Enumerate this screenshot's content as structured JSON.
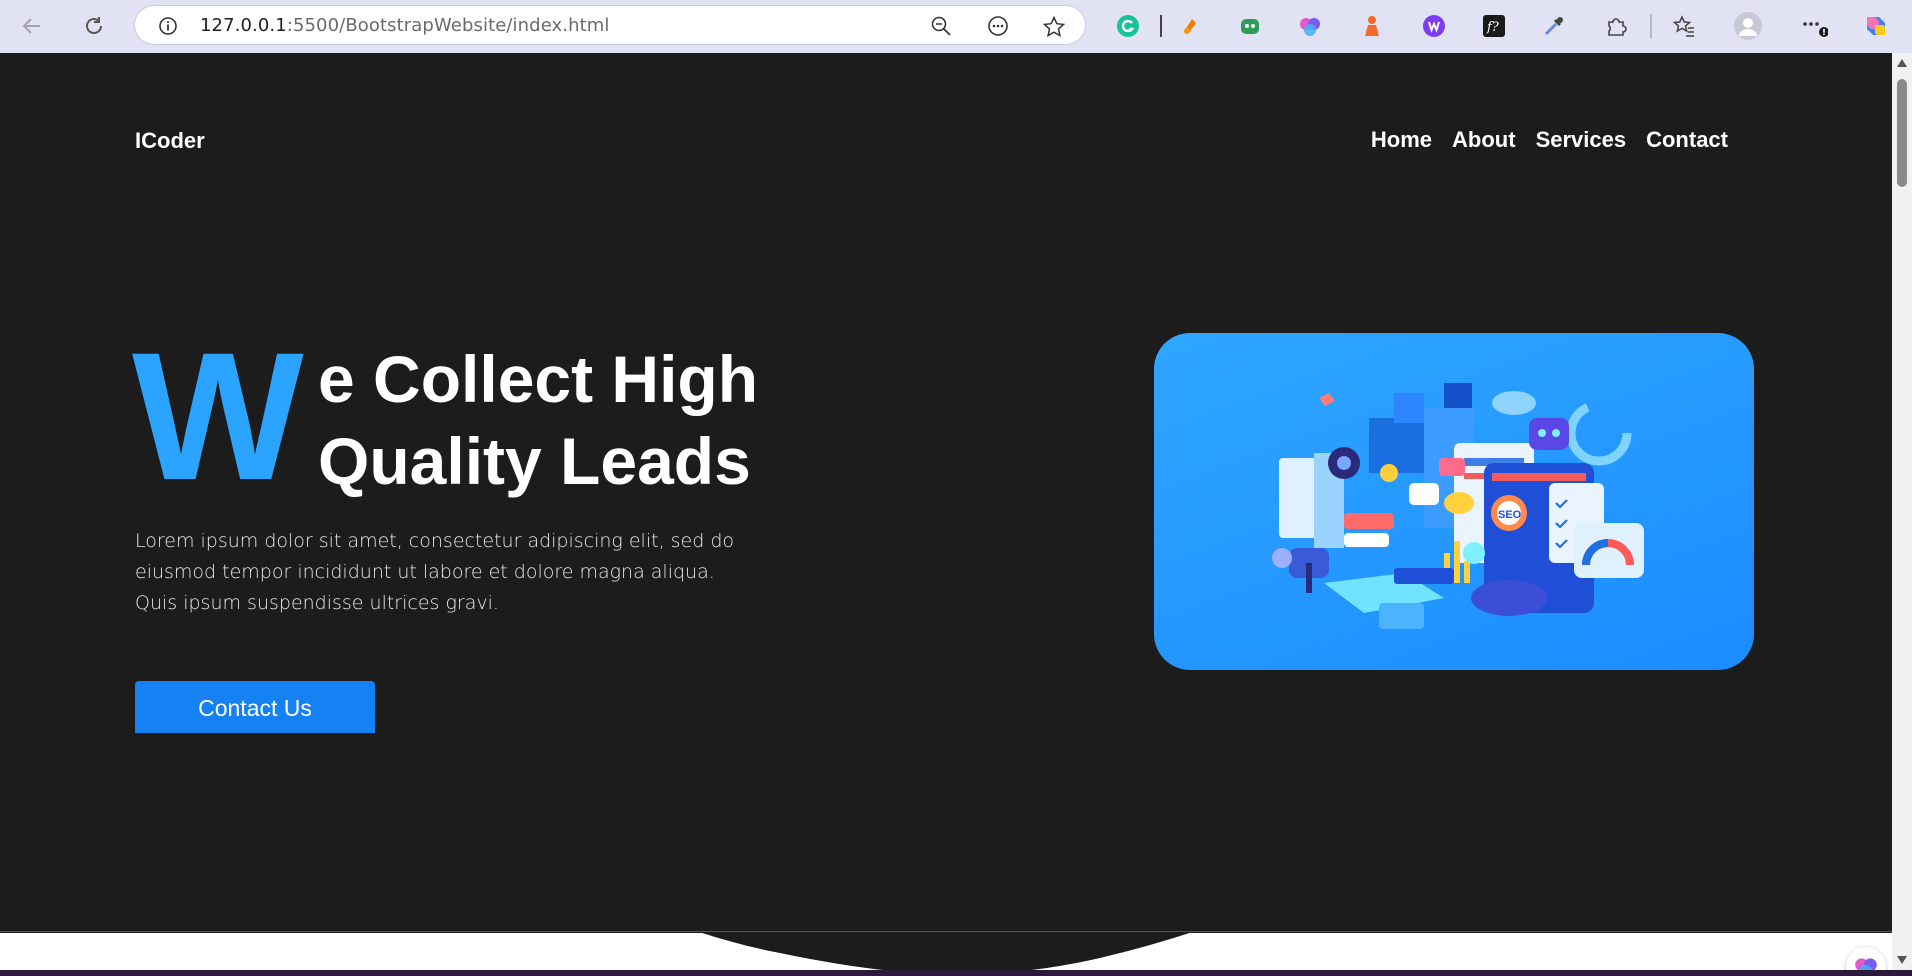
{
  "browser": {
    "url_host": "127.0.0.1",
    "url_rest": ":5500/BootstrapWebsite/index.html",
    "back_icon": "back-arrow-icon",
    "reload_icon": "reload-icon",
    "extensions": [
      "grammarly-icon",
      "orange-extension-icon",
      "robot-extension-icon",
      "brain-extension-icon",
      "figure-extension-icon",
      "purple-w-extension-icon",
      "f-question-extension-icon",
      "eyedropper-icon",
      "puzzle-extensions-icon",
      "favorites-icon",
      "profile-icon",
      "more-icon",
      "copilot-icon"
    ]
  },
  "site": {
    "brand": "ICoder",
    "nav": [
      "Home",
      "About",
      "Services",
      "Contact"
    ],
    "hero": {
      "big_letter": "W",
      "headline_line1": "e Collect High",
      "headline_line2": "Quality Leads",
      "lead_line1": "Lorem ipsum dolor sit amet, consectetur adipiscing elit, sed do",
      "lead_line2": "eiusmod tempor incididunt ut labore et dolore magna aliqua.",
      "lead_line3": "Quis ipsum suspendisse ultrices gravi.",
      "cta_label": "Contact Us",
      "image_badge": "SEO"
    }
  },
  "colors": {
    "hero_bg": "#1c1c1c",
    "accent": "#2aa4ff",
    "button": "#1581f3",
    "chrome_bg": "#e1e2f4"
  }
}
